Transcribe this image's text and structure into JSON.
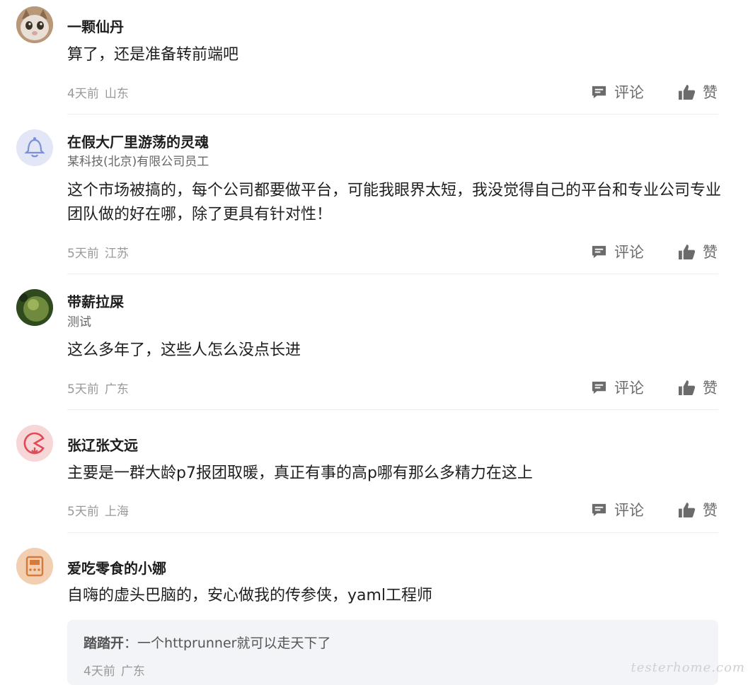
{
  "comments": [
    {
      "name": "一颗仙丹",
      "subtitle": "",
      "content": "算了，还是准备转前端吧",
      "time": "4天前",
      "location": "山东",
      "comment_label": "评论",
      "like_label": "赞",
      "avatar_icon": "cat-avatar"
    },
    {
      "name": "在假大厂里游荡的灵魂",
      "subtitle": "某科技(北京)有限公司员工",
      "content": "这个市场被搞的，每个公司都要做平台，可能我眼界太短，我没觉得自己的平台和专业公司专业团队做的好在哪，除了更具有针对性！",
      "time": "5天前",
      "location": "江苏",
      "comment_label": "评论",
      "like_label": "赞",
      "avatar_icon": "bell-avatar"
    },
    {
      "name": "带薪拉屎",
      "subtitle": "测试",
      "content": "这么多年了，这些人怎么没点长进",
      "time": "5天前",
      "location": "广东",
      "comment_label": "评论",
      "like_label": "赞",
      "avatar_icon": "photo-avatar"
    },
    {
      "name": "张辽张文远",
      "subtitle": "",
      "content": "主要是一群大龄p7报团取暖，真正有事的高p哪有那么多精力在这上",
      "time": "5天前",
      "location": "上海",
      "comment_label": "评论",
      "like_label": "赞",
      "avatar_icon": "pacman-avatar"
    },
    {
      "name": "爱吃零食的小娜",
      "subtitle": "",
      "content": "自嗨的虚头巴脑的，安心做我的传参侠，yaml工程师",
      "avatar_icon": "machine-avatar"
    }
  ],
  "reply": {
    "author": "踏踏开",
    "separator": "：",
    "text": "一个httprunner就可以走天下了",
    "time": "4天前",
    "location": "广东"
  },
  "watermark": "testerhome.com",
  "colors": {
    "text": "#1f1f1f",
    "muted": "#999999",
    "action": "#6b6b6b",
    "divider": "#eeeeee",
    "reply_bg": "#f3f4f7"
  }
}
